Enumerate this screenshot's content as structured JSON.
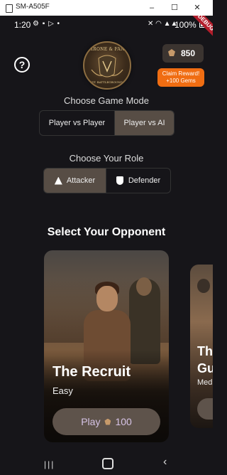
{
  "window": {
    "title": "SM-A505F",
    "minimize": "–",
    "maximize": "☐",
    "close": "✕"
  },
  "status": {
    "time": "1:20",
    "left_icons": "⚙ ▪ ▷ •",
    "right_icons": "✕ ◠ ▲▲",
    "battery": "100%",
    "debug": "DEBUG"
  },
  "header": {
    "help": "?",
    "logo_text": "THRONE & FANG",
    "logo_sub": "EST. BATTLEGROUNDS",
    "gems": "850",
    "claim_line1": "Claim Reward!",
    "claim_line2": "+100 Gems"
  },
  "mode": {
    "label": "Choose Game Mode",
    "options": [
      "Player vs Player",
      "Player vs AI"
    ],
    "selected": "Player vs AI"
  },
  "role": {
    "label": "Choose Your Role",
    "options": [
      "Attacker",
      "Defender"
    ],
    "selected": "Attacker"
  },
  "opponents": {
    "title": "Select Your Opponent",
    "cards": [
      {
        "name": "The Recruit",
        "difficulty": "Easy",
        "play_label": "Play",
        "cost": "100"
      },
      {
        "name_line1": "Th",
        "name_line2": "Gu",
        "difficulty": "Med"
      }
    ]
  },
  "colors": {
    "background": "#161519",
    "accent_orange": "#f06d12",
    "segment_active": "#574d45",
    "play_text": "#d6c3e6"
  },
  "navbar": {
    "recents": "|||",
    "back": "‹"
  }
}
